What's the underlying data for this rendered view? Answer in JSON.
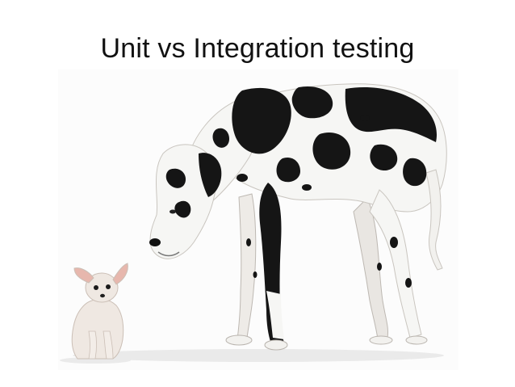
{
  "slide": {
    "title": "Unit vs Integration testing"
  },
  "image": {
    "subject": "chihuahua-and-great-dane-photo",
    "colors": {
      "background": "#ffffff",
      "coat_white": "#f6f6f4",
      "coat_black": "#151515",
      "chihuahua_coat": "#efe8e2",
      "ear_pink": "#e7b7ad"
    }
  }
}
